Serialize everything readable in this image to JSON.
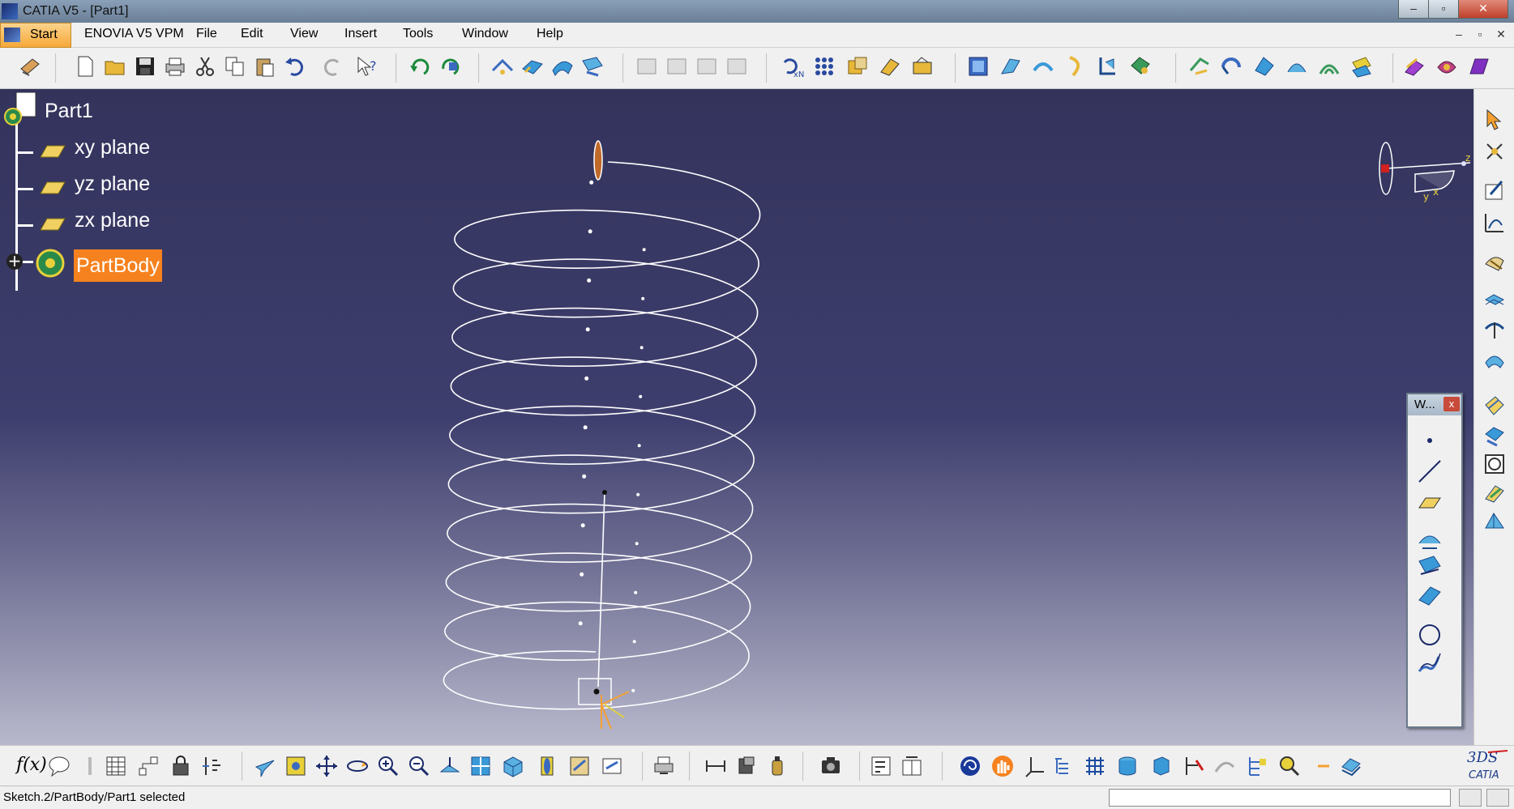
{
  "window": {
    "title": "CATIA V5 - [Part1]",
    "minimize": "–",
    "maximize": "▫",
    "close": "✕"
  },
  "menu": {
    "items": [
      "Start",
      "ENOVIA V5 VPM",
      "File",
      "Edit",
      "View",
      "Insert",
      "Tools",
      "Window",
      "Help"
    ]
  },
  "tree": {
    "root": "Part1",
    "children": [
      "xy plane",
      "yz plane",
      "zx plane",
      "PartBody"
    ],
    "expand_symbol": "+"
  },
  "compass": {
    "axis_x": "x",
    "axis_y": "y",
    "axis_z": "z"
  },
  "floating_toolbar": {
    "title": "W...",
    "close": "x"
  },
  "statusbar": {
    "message": "Sketch.2/PartBody/Part1 selected"
  },
  "logo": {
    "text": "CATIA"
  },
  "colors": {
    "selected_highlight": "#f5821f",
    "viewport_top": "#33335c",
    "viewport_bottom": "#b8b8cc"
  }
}
